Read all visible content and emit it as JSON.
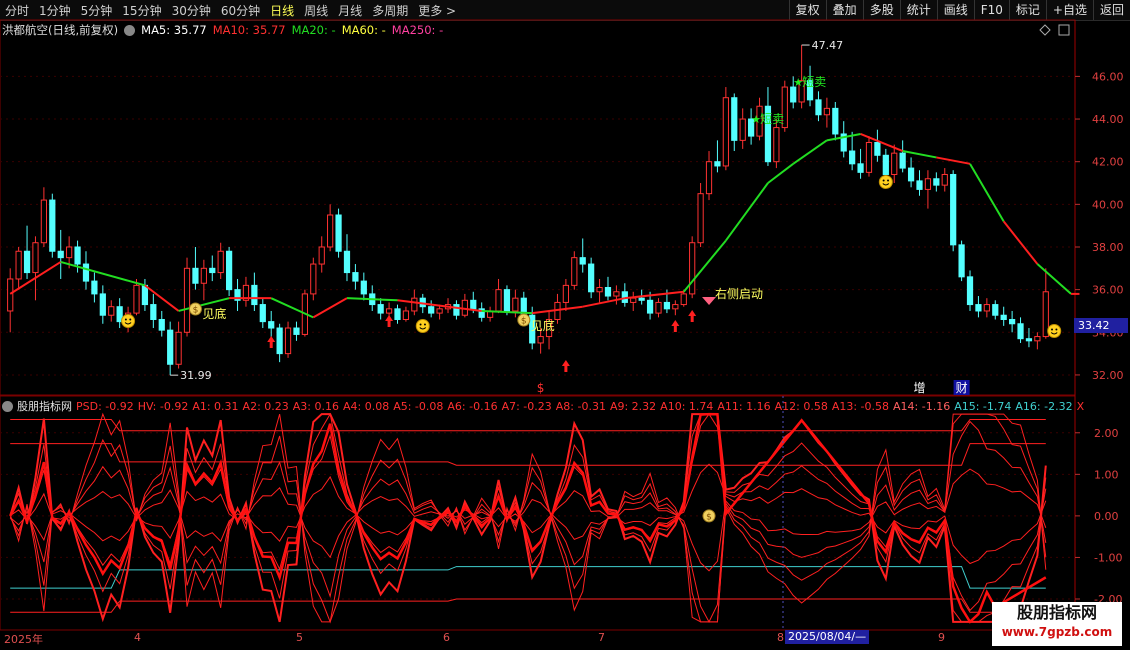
{
  "toolbar": {
    "periods": [
      "分时",
      "1分钟",
      "5分钟",
      "15分钟",
      "30分钟",
      "60分钟",
      "日线",
      "周线",
      "月线",
      "多周期",
      "更多 >"
    ],
    "active_period": "日线",
    "right_buttons": [
      "复权",
      "叠加",
      "多股",
      "统计",
      "画线",
      "F10",
      "标记",
      "+自选",
      "返回"
    ]
  },
  "main_header": {
    "title": "洪都航空(日线,前复权)",
    "ma5": "MA5: 35.77",
    "ma10": "MA10: 35.77",
    "ma20": "MA20: -",
    "ma60": "MA60: -",
    "ma250": "MA250: -"
  },
  "indicator_header": {
    "name": "股朋指标网",
    "values": [
      "PSD: -0.92",
      "HV: -0.92",
      "A1: 0.31",
      "A2: 0.23",
      "A3: 0.16",
      "A4: 0.08",
      "A5: -0.08",
      "A6: -0.16",
      "A7: -0.23",
      "A8: -0.31",
      "A9: 2.32",
      "A10: 1.74",
      "A11: 1.16",
      "A12: 0.58",
      "A13: -0.58",
      "A14: -1.16",
      "A15: -1.74",
      "A16: -2.32",
      "X"
    ]
  },
  "price_axis": [
    "46.00",
    "44.00",
    "42.00",
    "40.00",
    "38.00",
    "36.00",
    "34.00",
    "32.00"
  ],
  "indicator_axis": [
    "2.00",
    "1.00",
    "0.00",
    "-1.00",
    "-2.00"
  ],
  "current_price": "33.42",
  "x_axis": [
    "2025年",
    "4",
    "5",
    "6",
    "7",
    "8",
    "2025/08/04/—",
    "9"
  ],
  "annotations": {
    "high": "47.47",
    "low": "31.99",
    "bottom1": "见底",
    "bottom2": "见底",
    "sell1": "短卖",
    "sell2": "短卖",
    "right_start": "右侧启动",
    "tag_add": "增",
    "tag_fin": "财",
    "tag_dollar": "$"
  },
  "watermark": {
    "line1": "股朋指标网",
    "line2": "www.7gpzb.com"
  },
  "colors": {
    "up": "#ff3232",
    "down": "#54ffff",
    "ma_green": "#22dd22",
    "ma_red": "#ff1f1f",
    "indicator": "#ff2020"
  },
  "chart_data": {
    "type": "candlestick",
    "title": "洪都航空(日线,前复权)",
    "ylim": [
      31.2,
      47.8
    ],
    "candles": [
      [
        35.0,
        37.0,
        34.0,
        36.5
      ],
      [
        36.5,
        38.0,
        36.0,
        37.8
      ],
      [
        37.8,
        39.0,
        36.5,
        36.8
      ],
      [
        36.8,
        38.5,
        35.5,
        38.2
      ],
      [
        38.2,
        40.8,
        38.0,
        40.2
      ],
      [
        40.2,
        40.5,
        37.5,
        37.8
      ],
      [
        37.8,
        38.8,
        36.5,
        37.5
      ],
      [
        37.5,
        38.5,
        37.0,
        38.0
      ],
      [
        38.0,
        38.3,
        36.8,
        37.2
      ],
      [
        37.2,
        37.8,
        36.0,
        36.4
      ],
      [
        36.4,
        36.8,
        35.4,
        35.8
      ],
      [
        35.8,
        36.2,
        34.4,
        34.8
      ],
      [
        34.8,
        35.5,
        34.5,
        35.2
      ],
      [
        35.2,
        35.6,
        34.2,
        34.5
      ],
      [
        34.5,
        35.2,
        34.0,
        34.9
      ],
      [
        34.9,
        36.5,
        34.8,
        36.2
      ],
      [
        36.2,
        36.5,
        35.0,
        35.3
      ],
      [
        35.3,
        35.8,
        34.2,
        34.6
      ],
      [
        34.6,
        35.0,
        33.8,
        34.1
      ],
      [
        34.1,
        34.5,
        31.99,
        32.5
      ],
      [
        32.5,
        34.5,
        32.3,
        34.0
      ],
      [
        34.0,
        37.5,
        33.8,
        37.0
      ],
      [
        37.0,
        38.0,
        36.0,
        36.3
      ],
      [
        36.3,
        37.4,
        35.5,
        37.0
      ],
      [
        37.0,
        37.6,
        36.4,
        36.8
      ],
      [
        36.8,
        38.2,
        36.5,
        37.8
      ],
      [
        37.8,
        38.0,
        35.7,
        36.0
      ],
      [
        36.0,
        36.5,
        35.0,
        35.5
      ],
      [
        35.5,
        36.6,
        35.2,
        36.2
      ],
      [
        36.2,
        36.8,
        35.0,
        35.3
      ],
      [
        35.3,
        35.6,
        34.2,
        34.5
      ],
      [
        34.5,
        35.0,
        33.5,
        34.2
      ],
      [
        34.2,
        34.4,
        32.6,
        33.0
      ],
      [
        33.0,
        34.5,
        32.8,
        34.2
      ],
      [
        34.2,
        34.5,
        33.6,
        33.9
      ],
      [
        33.9,
        36.0,
        33.8,
        35.8
      ],
      [
        35.8,
        37.5,
        35.5,
        37.2
      ],
      [
        37.2,
        38.5,
        36.8,
        38.0
      ],
      [
        38.0,
        40.0,
        37.8,
        39.5
      ],
      [
        39.5,
        39.8,
        37.5,
        37.8
      ],
      [
        37.8,
        38.6,
        36.4,
        36.8
      ],
      [
        36.8,
        37.2,
        36.0,
        36.4
      ],
      [
        36.4,
        36.8,
        35.5,
        35.8
      ],
      [
        35.8,
        36.2,
        35.0,
        35.3
      ],
      [
        35.3,
        35.6,
        34.6,
        34.9
      ],
      [
        34.9,
        35.4,
        34.5,
        35.1
      ],
      [
        35.1,
        35.3,
        34.4,
        34.6
      ],
      [
        34.6,
        35.2,
        34.5,
        35.0
      ],
      [
        35.0,
        36.0,
        34.8,
        35.6
      ],
      [
        35.6,
        35.8,
        34.9,
        35.2
      ],
      [
        35.2,
        35.5,
        34.7,
        34.9
      ],
      [
        34.9,
        35.3,
        34.6,
        35.1
      ],
      [
        35.1,
        35.6,
        34.9,
        35.3
      ],
      [
        35.3,
        35.5,
        34.6,
        34.8
      ],
      [
        34.8,
        35.8,
        34.7,
        35.5
      ],
      [
        35.5,
        35.9,
        34.9,
        35.1
      ],
      [
        35.1,
        35.4,
        34.5,
        34.7
      ],
      [
        34.7,
        35.2,
        34.5,
        35.0
      ],
      [
        35.0,
        36.5,
        34.9,
        36.0
      ],
      [
        36.0,
        36.2,
        34.8,
        35.0
      ],
      [
        35.0,
        36.0,
        34.7,
        35.6
      ],
      [
        35.6,
        35.9,
        34.6,
        34.8
      ],
      [
        34.8,
        35.2,
        33.2,
        33.5
      ],
      [
        33.5,
        34.2,
        33.0,
        33.8
      ],
      [
        33.8,
        35.0,
        33.2,
        34.6
      ],
      [
        34.6,
        35.8,
        34.4,
        35.4
      ],
      [
        35.4,
        36.5,
        35.0,
        36.2
      ],
      [
        36.2,
        37.8,
        36.0,
        37.5
      ],
      [
        37.5,
        38.4,
        36.8,
        37.2
      ],
      [
        37.2,
        37.5,
        35.6,
        35.9
      ],
      [
        35.9,
        36.5,
        35.4,
        36.1
      ],
      [
        36.1,
        36.6,
        35.5,
        35.7
      ],
      [
        35.7,
        36.2,
        35.3,
        35.9
      ],
      [
        35.9,
        36.3,
        35.2,
        35.4
      ],
      [
        35.4,
        35.9,
        35.0,
        35.6
      ],
      [
        35.6,
        36.0,
        35.3,
        35.5
      ],
      [
        35.5,
        35.9,
        34.6,
        34.9
      ],
      [
        34.9,
        35.6,
        34.7,
        35.4
      ],
      [
        35.4,
        36.0,
        34.9,
        35.1
      ],
      [
        35.1,
        35.5,
        34.8,
        35.3
      ],
      [
        35.3,
        36.0,
        35.2,
        35.8
      ],
      [
        35.8,
        38.5,
        35.6,
        38.2
      ],
      [
        38.2,
        41.0,
        38.0,
        40.5
      ],
      [
        40.5,
        42.5,
        40.2,
        42.0
      ],
      [
        42.0,
        43.0,
        41.5,
        41.8
      ],
      [
        41.8,
        45.5,
        41.6,
        45.0
      ],
      [
        45.0,
        45.2,
        42.5,
        43.0
      ],
      [
        43.0,
        44.5,
        42.6,
        44.0
      ],
      [
        44.0,
        44.5,
        42.8,
        43.2
      ],
      [
        43.2,
        45.0,
        43.0,
        44.6
      ],
      [
        44.6,
        45.5,
        41.8,
        42.0
      ],
      [
        42.0,
        44.0,
        41.7,
        43.6
      ],
      [
        43.6,
        45.8,
        43.4,
        45.5
      ],
      [
        45.5,
        46.0,
        44.5,
        44.8
      ],
      [
        44.8,
        47.47,
        44.5,
        45.8
      ],
      [
        45.8,
        46.5,
        44.6,
        44.9
      ],
      [
        44.9,
        45.3,
        43.9,
        44.2
      ],
      [
        44.2,
        45.0,
        43.6,
        44.5
      ],
      [
        44.5,
        44.8,
        43.0,
        43.3
      ],
      [
        43.3,
        43.9,
        42.2,
        42.5
      ],
      [
        42.5,
        43.4,
        41.6,
        41.9
      ],
      [
        41.9,
        42.6,
        41.2,
        41.5
      ],
      [
        41.5,
        43.2,
        41.3,
        42.9
      ],
      [
        42.9,
        43.5,
        42.0,
        42.3
      ],
      [
        42.3,
        42.6,
        41.2,
        41.4
      ],
      [
        41.4,
        42.8,
        41.0,
        42.4
      ],
      [
        42.4,
        43.0,
        41.5,
        41.7
      ],
      [
        41.7,
        42.2,
        40.8,
        41.1
      ],
      [
        41.1,
        41.6,
        40.4,
        40.7
      ],
      [
        40.7,
        41.6,
        39.8,
        41.2
      ],
      [
        41.2,
        41.5,
        40.6,
        40.9
      ],
      [
        40.9,
        41.7,
        40.6,
        41.4
      ],
      [
        41.4,
        41.6,
        37.8,
        38.1
      ],
      [
        38.1,
        38.3,
        36.4,
        36.6
      ],
      [
        36.6,
        36.9,
        35.0,
        35.3
      ],
      [
        35.3,
        35.7,
        34.7,
        35.0
      ],
      [
        35.0,
        35.6,
        34.7,
        35.3
      ],
      [
        35.3,
        35.5,
        34.6,
        34.8
      ],
      [
        34.8,
        35.2,
        34.3,
        34.6
      ],
      [
        34.6,
        35.0,
        34.0,
        34.4
      ],
      [
        34.4,
        34.7,
        33.5,
        33.7
      ],
      [
        33.7,
        34.2,
        33.3,
        33.6
      ],
      [
        33.6,
        34.0,
        33.2,
        33.8
      ],
      [
        33.8,
        37.0,
        33.7,
        35.9
      ]
    ],
    "ma_line_red_green": [
      [
        0,
        35.8
      ],
      [
        6,
        37.3
      ],
      [
        16,
        36.2
      ],
      [
        20,
        35.0
      ],
      [
        26,
        35.6
      ],
      [
        31,
        35.6
      ],
      [
        36,
        34.7
      ],
      [
        40,
        35.6
      ],
      [
        46,
        35.5
      ],
      [
        56,
        35.0
      ],
      [
        62,
        34.9
      ],
      [
        68,
        35.2
      ],
      [
        73,
        35.6
      ],
      [
        80,
        35.9
      ],
      [
        85,
        38.3
      ],
      [
        90,
        41.0
      ],
      [
        93,
        41.9
      ],
      [
        97,
        43.0
      ],
      [
        101,
        43.3
      ],
      [
        106,
        42.5
      ],
      [
        110,
        42.2
      ],
      [
        114,
        41.9
      ],
      [
        118,
        39.2
      ],
      [
        122,
        37.2
      ],
      [
        126,
        35.8
      ],
      [
        127,
        35.8
      ]
    ],
    "ma_segment_colors": [
      "red",
      "green",
      "red",
      "green",
      "red",
      "green",
      "red",
      "green",
      "red",
      "green",
      "red",
      "red",
      "red",
      "green",
      "green",
      "green",
      "green",
      "green"
    ]
  }
}
